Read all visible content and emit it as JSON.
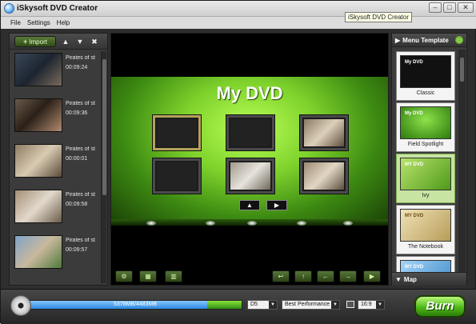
{
  "window": {
    "title": "iSkysoft DVD Creator",
    "tooltip": "iSkysoft DVD Creator"
  },
  "menu": {
    "items": [
      "File",
      "Settings",
      "Help"
    ]
  },
  "left": {
    "import_label": "Import",
    "clips": [
      {
        "name": "Pirates of st",
        "duration": "00:09:24"
      },
      {
        "name": "Pirates of st",
        "duration": "00:09:36"
      },
      {
        "name": "Pirates of st",
        "duration": "00:00:01"
      },
      {
        "name": "Pirates of st",
        "duration": "00:09:58"
      },
      {
        "name": "Pirates of st",
        "duration": "00:09:57"
      }
    ]
  },
  "preview": {
    "dvd_title": "My DVD"
  },
  "templates": {
    "header": "Menu Template",
    "items": [
      {
        "label": "Classic",
        "mini": "My DVD",
        "selected": false
      },
      {
        "label": "Field Spotlight",
        "mini": "My DVD",
        "selected": false
      },
      {
        "label": "Ivy",
        "mini": "MY DVD",
        "selected": true
      },
      {
        "label": "The Notebook",
        "mini": "MY DVD",
        "selected": false
      },
      {
        "label": "",
        "mini": "MY DVD",
        "selected": false
      }
    ],
    "map_label": "Map"
  },
  "bottom": {
    "capacity_text": "5378MB/4483MB",
    "disc_type": "D5",
    "quality": "Best Performance",
    "aspect": "16:9",
    "burn_label": "Burn",
    "progress": {
      "blue_fraction": 0.84,
      "green_fraction": 0.16
    }
  },
  "colors": {
    "accent_green": "#6fd12a",
    "progress_blue": "#2d88e0"
  }
}
